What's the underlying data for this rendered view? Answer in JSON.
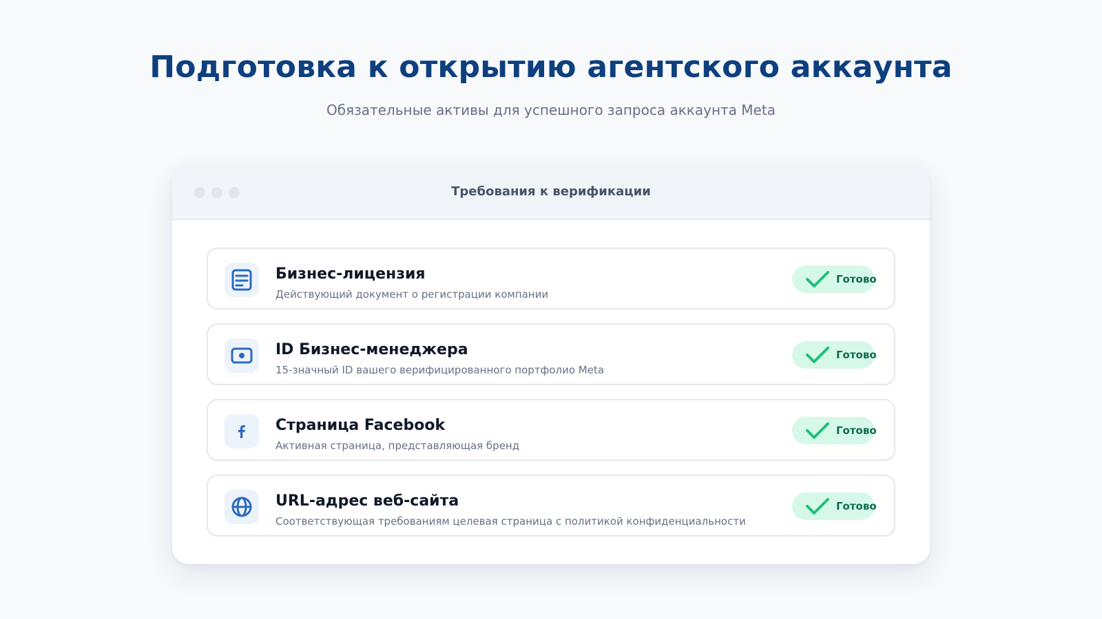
{
  "header": {
    "title": "Подготовка к открытию агентского аккаунта",
    "subtitle": "Обязательные активы для успешного запроса аккаунта Meta"
  },
  "window": {
    "title": "Требования к верификации"
  },
  "requirements": [
    {
      "icon": "document-icon",
      "title": "Бизнес-лицензия",
      "description": "Действующий документ о регистрации компании",
      "status": "Готово"
    },
    {
      "icon": "id-card-icon",
      "title": "ID Бизнес-менеджера",
      "description": "15-значный ID вашего верифицированного портфолио Meta",
      "status": "Готово"
    },
    {
      "icon": "facebook-icon",
      "title": "Страница Facebook",
      "description": "Активная страница, представляющая бренд",
      "status": "Готово"
    },
    {
      "icon": "globe-icon",
      "title": "URL-адрес веб-сайта",
      "description": "Соответствующая требованиям целевая страница с политикой конфиденциальности",
      "status": "Готово"
    }
  ],
  "colors": {
    "accent": "#0e3f7e",
    "icon_blue": "#2a6bbf",
    "success_bg": "#d6f8e8",
    "success_check": "#1fbf7a",
    "success_text": "#0e6b4e"
  }
}
